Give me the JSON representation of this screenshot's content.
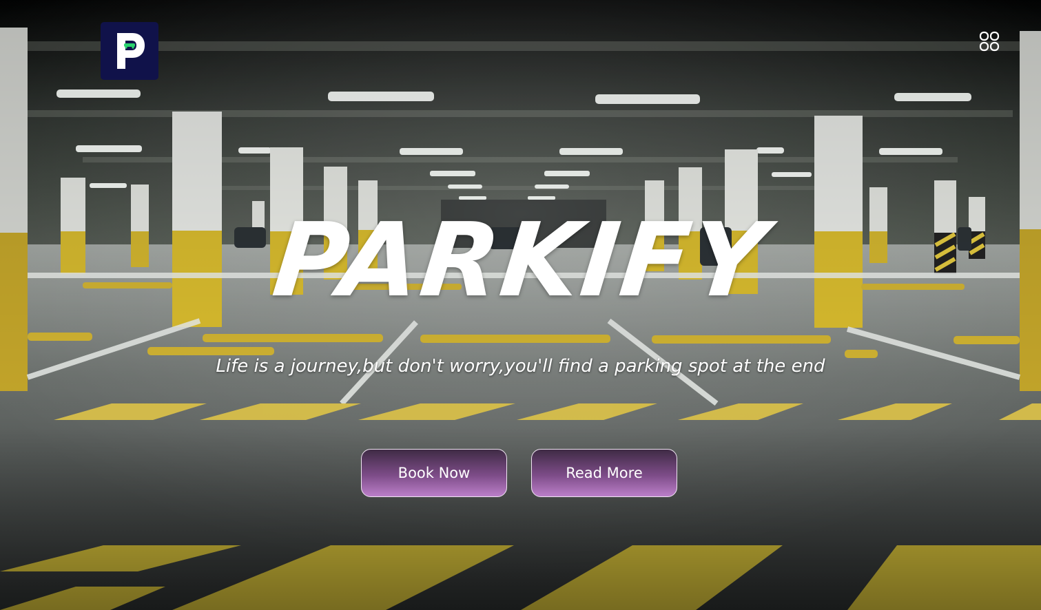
{
  "logo": {
    "letter": "P",
    "icon": "parking-p-logo",
    "background_color": "#10124a"
  },
  "menu": {
    "icon": "grid-menu-icon"
  },
  "hero": {
    "title": "PARKIFY",
    "tagline": "Life is a journey,but don't worry,you'll find a parking spot at the end",
    "background": "underground-parking-garage-photo"
  },
  "buttons": {
    "book_now": "Book Now",
    "read_more": "Read More"
  },
  "colors": {
    "button_gradient_top": "#3f2b45",
    "button_gradient_bottom": "#bb7fc9",
    "text": "#ffffff",
    "floor_marking_yellow": "#e3c93f"
  }
}
